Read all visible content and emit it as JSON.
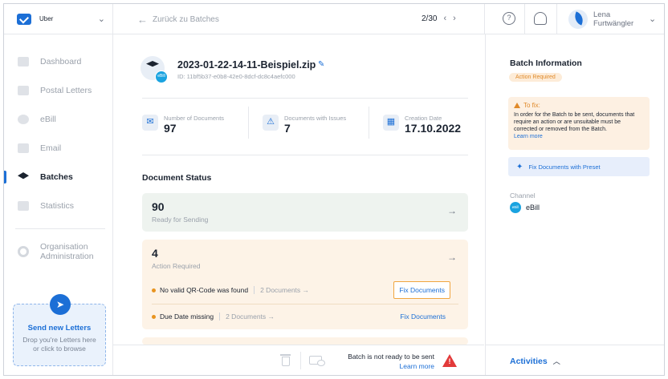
{
  "org": {
    "name": "Uber"
  },
  "nav": [
    {
      "label": "Dashboard"
    },
    {
      "label": "Postal Letters"
    },
    {
      "label": "eBill"
    },
    {
      "label": "Email"
    },
    {
      "label": "Batches"
    },
    {
      "label": "Statistics"
    }
  ],
  "admin": {
    "line1": "Organisation",
    "line2": "Administration"
  },
  "upload": {
    "title": "Send new Letters",
    "line1": "Drop you're Letters here",
    "line2": "or click to browse"
  },
  "topbar": {
    "back_label": "Zurück zu Batches",
    "pager": "2/30",
    "help_icon_glyph": "?",
    "user_first": "Lena",
    "user_last": "Furtwängler"
  },
  "batch": {
    "file_name": "2023-01-22-14-11-Beispiel.zip",
    "id": "ID: 11bf5b37-e0b8-42e0-8dcf-dc8c4aefc000",
    "badge": "eBill"
  },
  "stats": [
    {
      "label": "Number of Documents",
      "value": "97",
      "icon": "envelope-icon"
    },
    {
      "label": "Documents with Issues",
      "value": "7",
      "icon": "warning-icon"
    },
    {
      "label": "Creation Date",
      "value": "17.10.2022",
      "icon": "calendar-icon"
    }
  ],
  "status": {
    "title": "Document Status",
    "ready": {
      "count": "90",
      "label": "Ready for Sending"
    },
    "action": {
      "count": "4",
      "label": "Action Required",
      "issues": [
        {
          "text": "No valid QR-Code was found",
          "docs": "2 Documents →",
          "fix": "Fix Documents"
        },
        {
          "text": "Due Date missing",
          "docs": "2 Documents →",
          "fix": "Fix Documents"
        }
      ]
    }
  },
  "footer": {
    "not_ready": "Batch is not ready to be sent",
    "learn_more": "Learn more"
  },
  "info": {
    "title": "Batch Information",
    "badge": "Action Required",
    "fix_title": "To fix:",
    "fix_body": "In order for the Batch to be sent, documents that require an action or are unsuitable must be corrected or removed from the Batch.",
    "fix_link": "Learn more",
    "preset_label": "Fix Documents with Preset",
    "channel_label": "Channel",
    "channel_value": "eBill",
    "channel_badge": "eBill",
    "activities": "Activities"
  },
  "colors": {
    "accent": "#1c6fd6",
    "warning": "#e08a2a",
    "danger": "#e23a3a"
  }
}
